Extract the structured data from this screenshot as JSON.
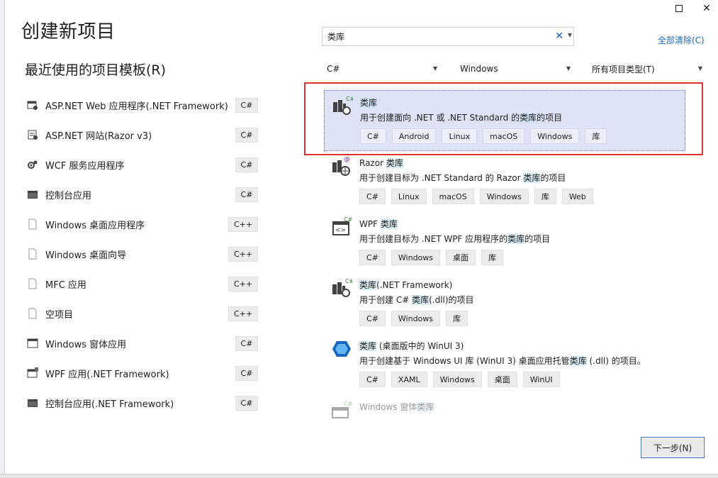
{
  "window": {
    "maximize_icon": "maximize-icon",
    "close_icon": "close-icon"
  },
  "page_title": "创建新项目",
  "recent": {
    "heading": "最近使用的项目模板(R)",
    "items": [
      {
        "label": "ASP.NET Web 应用程序(.NET Framework)",
        "lang": "C#",
        "icon": "web-project-icon"
      },
      {
        "label": "ASP.NET 网站(Razor v3)",
        "lang": "C#",
        "icon": "website-icon"
      },
      {
        "label": "WCF 服务应用程序",
        "lang": "C#",
        "icon": "service-icon"
      },
      {
        "label": "控制台应用",
        "lang": "C#",
        "icon": "console-icon"
      },
      {
        "label": "Windows 桌面应用程序",
        "lang": "C++",
        "icon": "file-icon"
      },
      {
        "label": "Windows 桌面向导",
        "lang": "C++",
        "icon": "file-icon"
      },
      {
        "label": "MFC 应用",
        "lang": "C++",
        "icon": "file-icon"
      },
      {
        "label": "空项目",
        "lang": "C++",
        "icon": "file-icon"
      },
      {
        "label": "Windows 窗体应用",
        "lang": "C#",
        "icon": "window-form-icon"
      },
      {
        "label": "WPF 应用(.NET Framework)",
        "lang": "C#",
        "icon": "wpf-icon"
      },
      {
        "label": "控制台应用(.NET Framework)",
        "lang": "C#",
        "icon": "console-icon"
      }
    ]
  },
  "search": {
    "value": "类库",
    "clear_icon": "clear-icon",
    "dropdown_icon": "dropdown-arrow-icon",
    "clear_all": "全部清除(C)"
  },
  "filters": {
    "language": "C#",
    "platform": "Windows",
    "project_type": "所有项目类型(T)"
  },
  "results": [
    {
      "title_pre": "",
      "title_hl": "类库",
      "title_post": "",
      "desc_pre": "用于创建面向 .NET 或 .NET Standard 的",
      "desc_hl": "类库",
      "desc_post": "的项目",
      "tags": [
        "C#",
        "Android",
        "Linux",
        "macOS",
        "Windows",
        "库"
      ],
      "icon": "class-library-icon"
    },
    {
      "title_pre": "Razor ",
      "title_hl": "类库",
      "title_post": "",
      "desc_pre": "用于创建目标为 .NET Standard 的 Razor ",
      "desc_hl": "类库",
      "desc_post": "的项目",
      "tags": [
        "C#",
        "Linux",
        "macOS",
        "Windows",
        "库",
        "Web"
      ],
      "icon": "razor-library-icon"
    },
    {
      "title_pre": "WPF ",
      "title_hl": "类库",
      "title_post": "",
      "desc_pre": "用于创建目标为 .NET WPF 应用程序的",
      "desc_hl": "类库",
      "desc_post": "的项目",
      "tags": [
        "C#",
        "Windows",
        "桌面",
        "库"
      ],
      "icon": "wpf-library-icon"
    },
    {
      "title_pre": "",
      "title_hl": "类库",
      "title_post": "(.NET Framework)",
      "desc_pre": "用于创建 C# ",
      "desc_hl": "类库",
      "desc_post": "(.dll)的项目",
      "tags": [
        "C#",
        "Windows",
        "库"
      ],
      "icon": "framework-library-icon"
    },
    {
      "title_pre": "",
      "title_hl": "类库",
      "title_post": " (桌面版中的 WinUI 3)",
      "desc_pre": "用于创建基于 Windows UI 库 (WinUI 3) 桌面应用托管",
      "desc_hl": "类库",
      "desc_post": " (.dll) 的项目。",
      "tags": [
        "C#",
        "XAML",
        "Windows",
        "桌面",
        "WinUI"
      ],
      "icon": "winui-icon"
    },
    {
      "title_pre": "Windows 窗体",
      "title_hl": "类库",
      "title_post": "",
      "desc_pre": "",
      "desc_hl": "",
      "desc_post": "",
      "tags": [],
      "icon": "winforms-library-icon"
    }
  ],
  "next_button": "下一步(N)",
  "colors": {
    "selection": "#dfe3f7",
    "highlight_frame": "#e0312f",
    "link": "#1a66c6"
  }
}
